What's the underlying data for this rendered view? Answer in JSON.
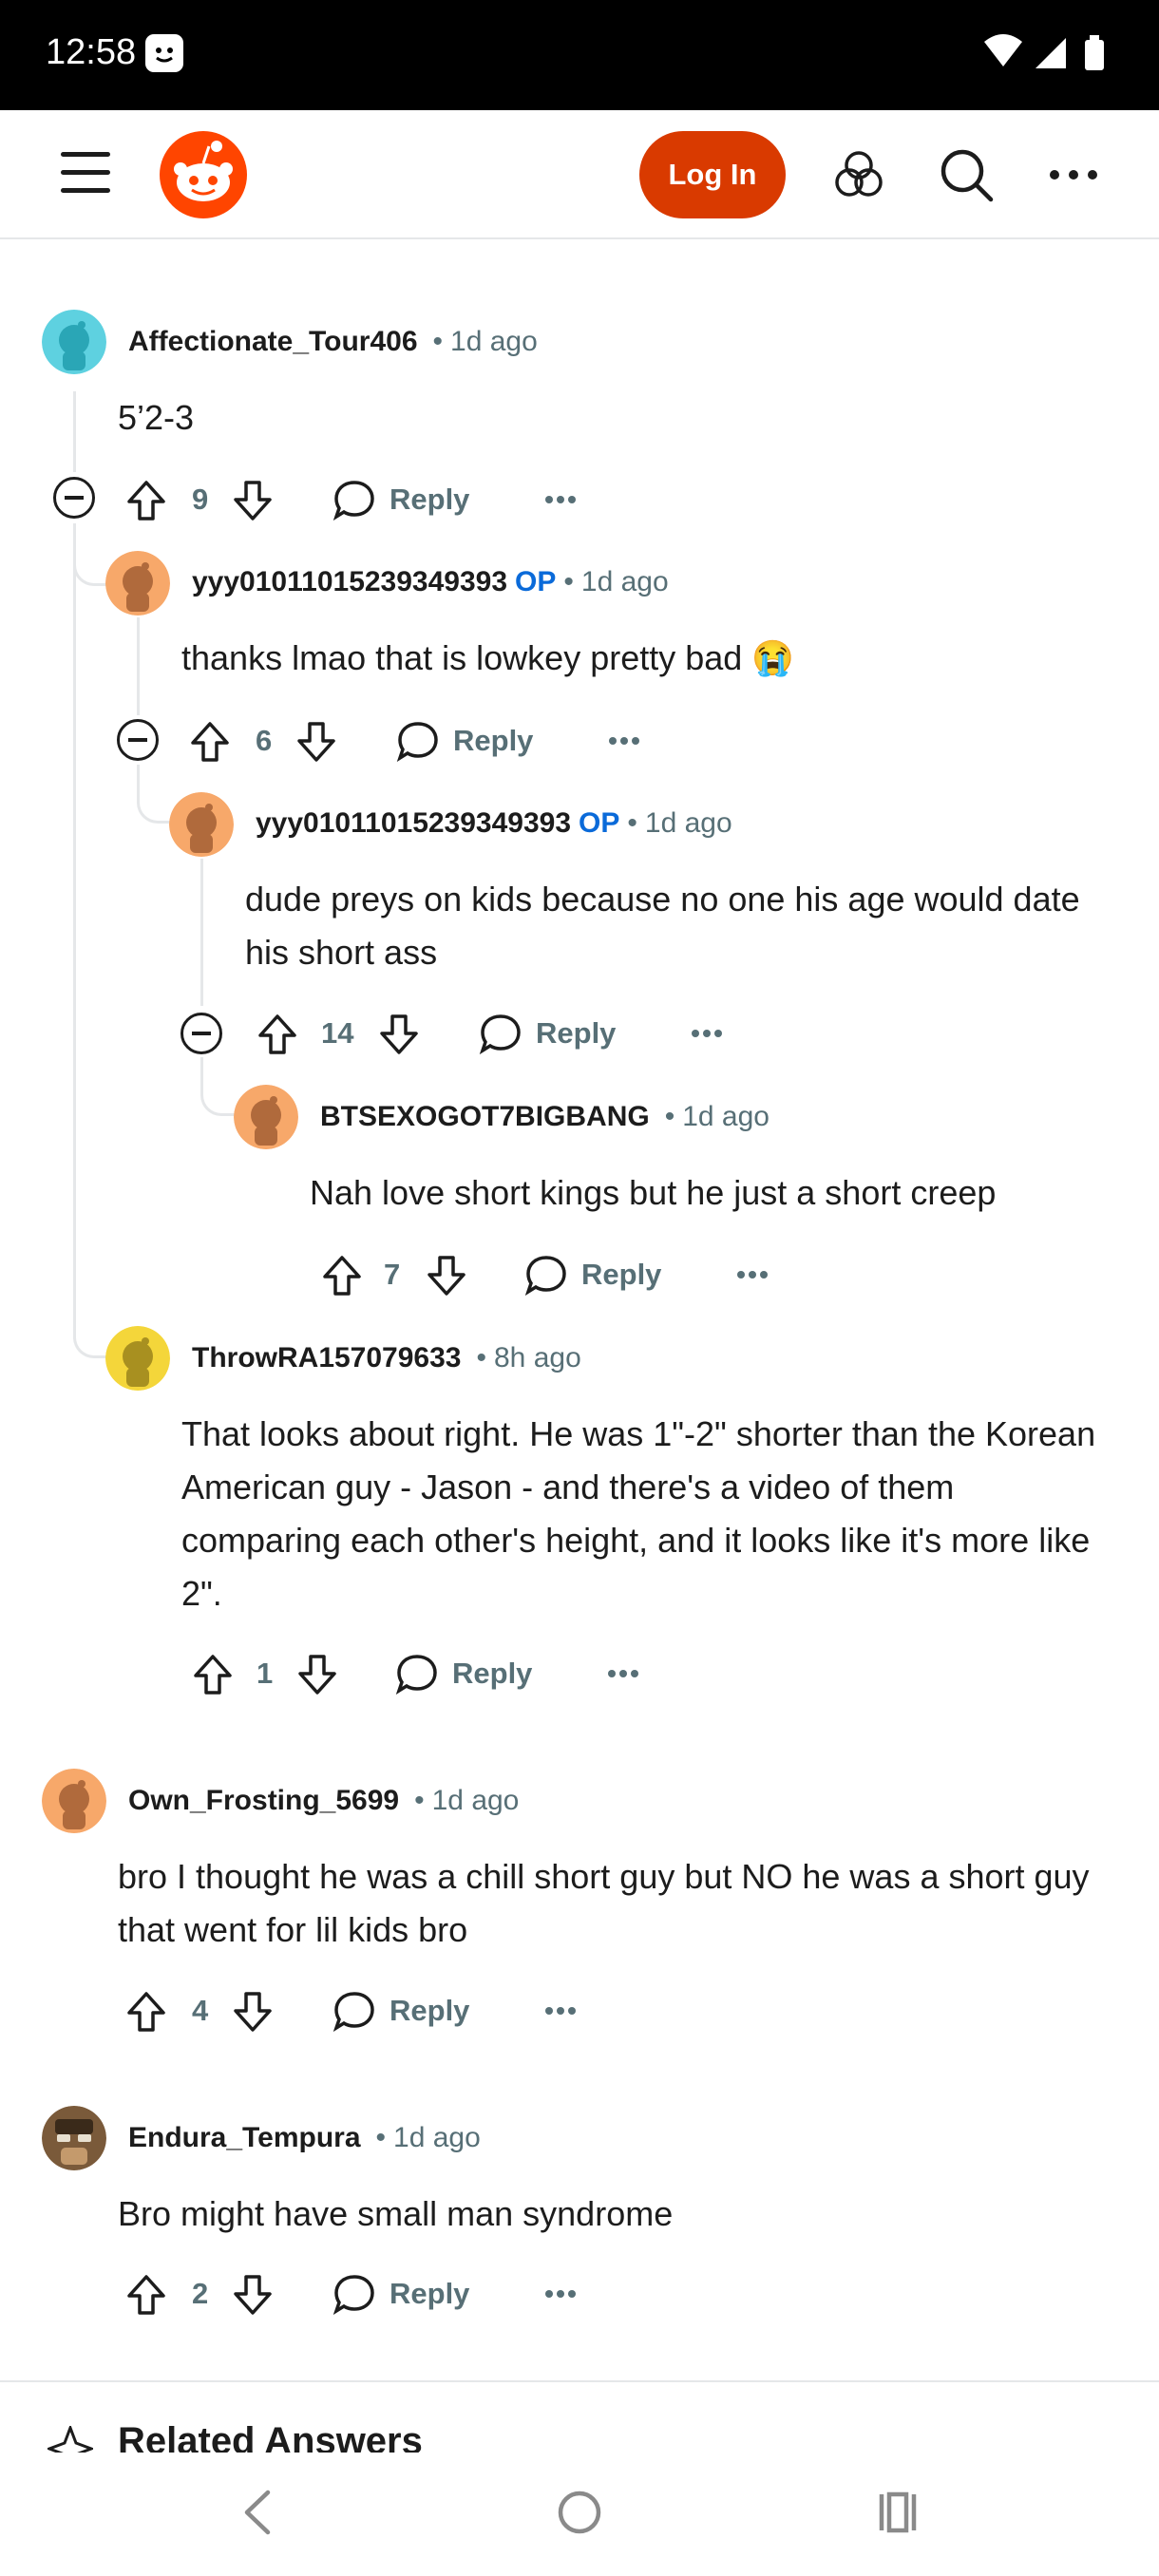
{
  "status_bar": {
    "time": "12:58"
  },
  "header": {
    "login_label": "Log In"
  },
  "colors": {
    "accent": "#d93a00",
    "op": "#0a6ad9",
    "meta": "#576f76"
  },
  "comments": [
    {
      "user": "Affectionate_Tour406",
      "op": "",
      "dot": "•",
      "ago": "1d ago",
      "body": "5’2-3",
      "votes": "9",
      "reply": "Reply"
    },
    {
      "user": "yyy01011015239349393",
      "op": "OP",
      "dot": "•",
      "ago": "1d ago",
      "body": "thanks lmao that is lowkey pretty bad 😭",
      "votes": "6",
      "reply": "Reply"
    },
    {
      "user": "yyy01011015239349393",
      "op": "OP",
      "dot": "•",
      "ago": "1d ago",
      "body": "dude preys on kids because no one his age would date his short ass",
      "votes": "14",
      "reply": "Reply"
    },
    {
      "user": "BTSEXOGOT7BIGBANG",
      "op": "",
      "dot": "•",
      "ago": "1d ago",
      "body": "Nah love short kings but he just a short creep",
      "votes": "7",
      "reply": "Reply"
    },
    {
      "user": "ThrowRA157079633",
      "op": "",
      "dot": "•",
      "ago": "8h ago",
      "body": "That looks about right. He was 1\"-2\" shorter than the Korean American guy - Jason - and there's a video of them comparing each other's height, and it looks like it's more like 2\".",
      "votes": "1",
      "reply": "Reply"
    },
    {
      "user": "Own_Frosting_5699",
      "op": "",
      "dot": "•",
      "ago": "1d ago",
      "body": "bro I thought he was a chill short guy but NO he was a short guy that went for lil kids bro",
      "votes": "4",
      "reply": "Reply"
    },
    {
      "user": "Endura_Tempura",
      "op": "",
      "dot": "•",
      "ago": "1d ago",
      "body": "Bro might have small man syndrome",
      "votes": "2",
      "reply": "Reply"
    }
  ],
  "related": {
    "title": "Related Answers"
  }
}
